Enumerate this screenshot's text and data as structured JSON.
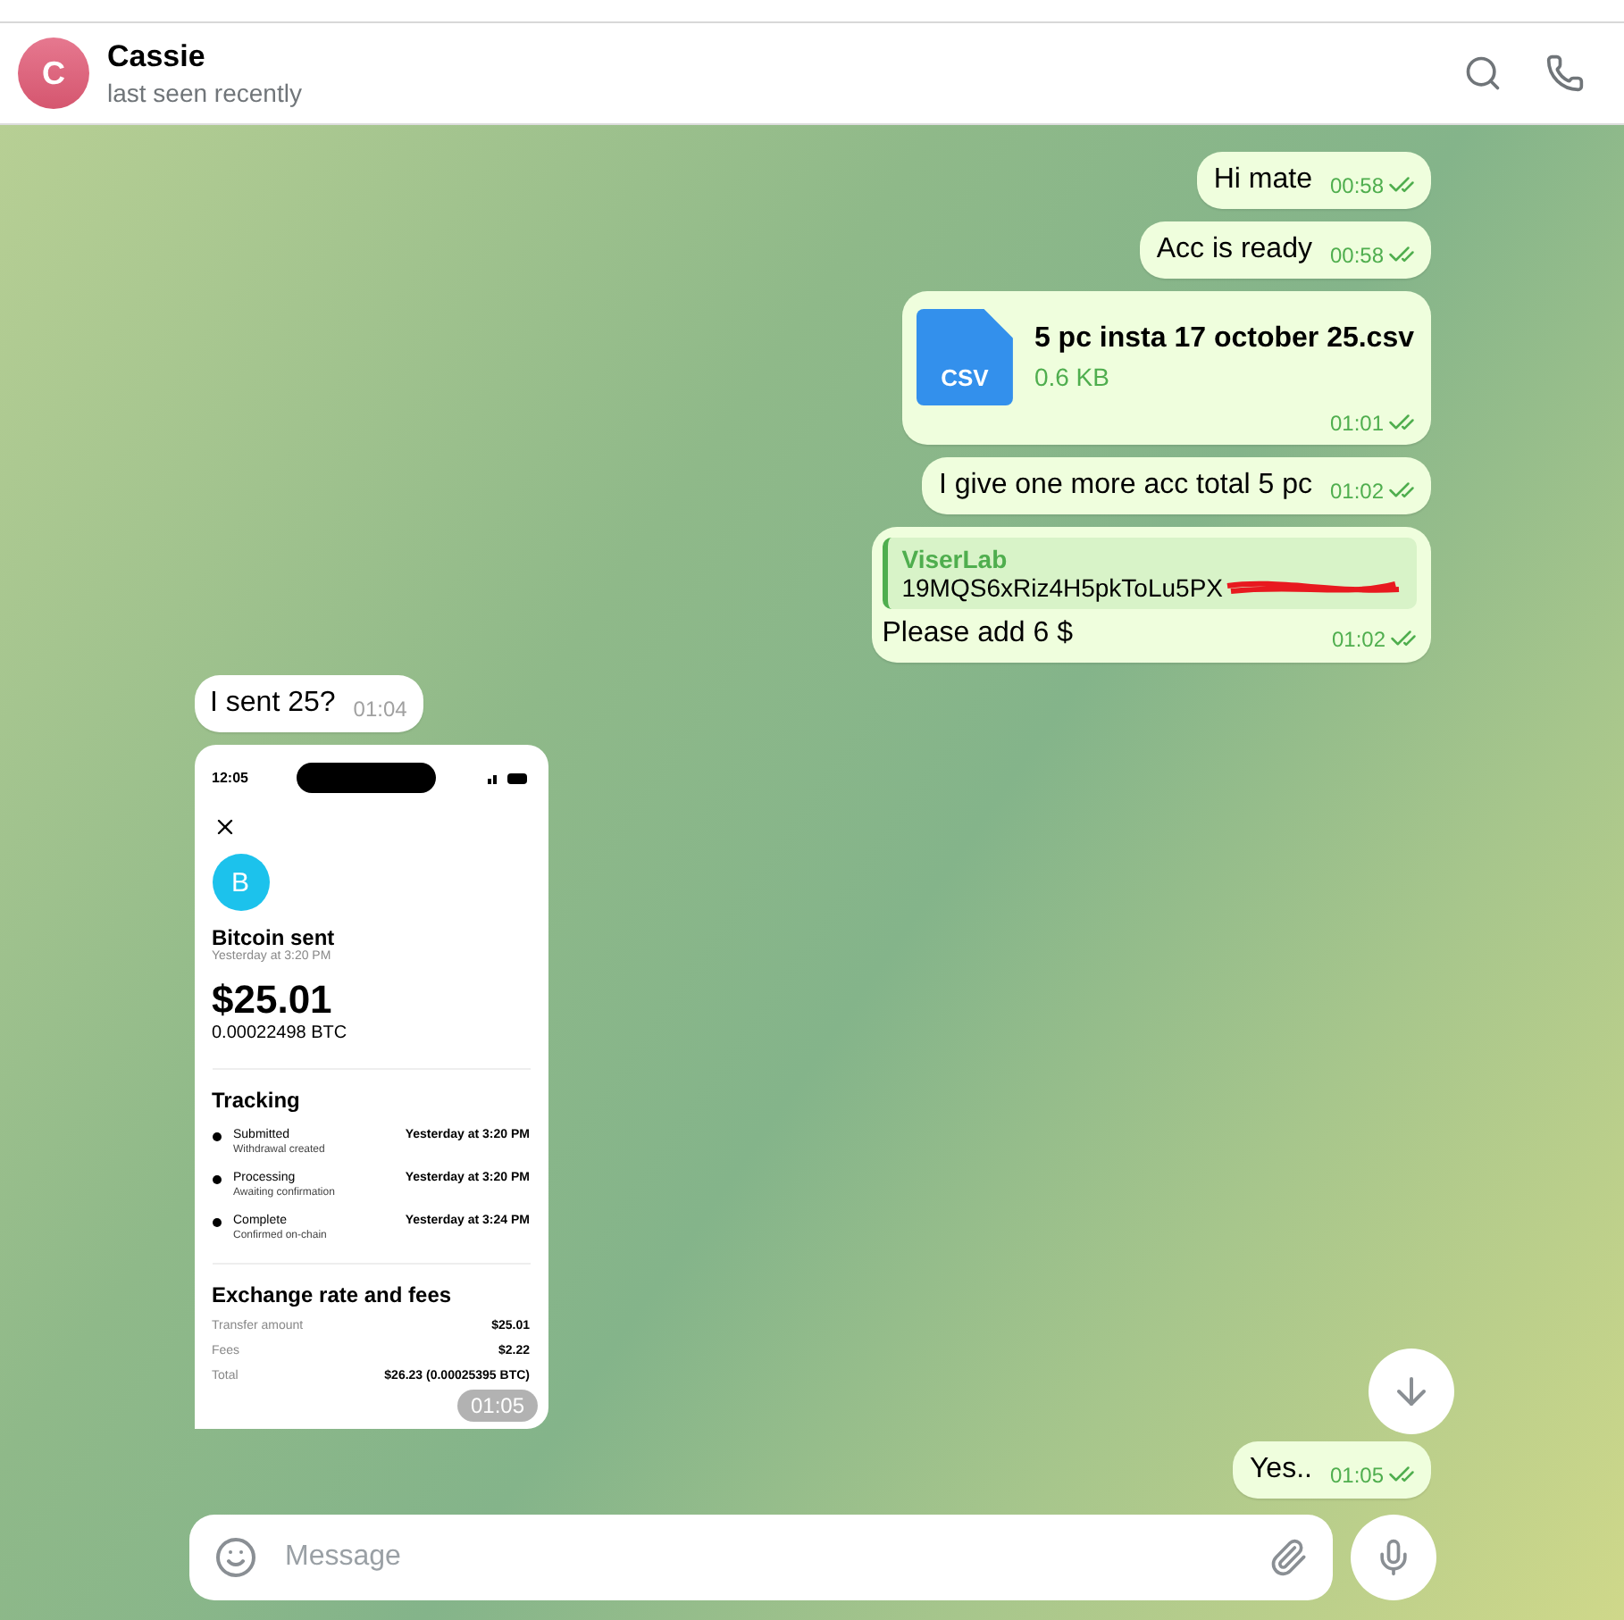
{
  "header": {
    "avatar_letter": "C",
    "name": "Cassie",
    "status": "last seen recently"
  },
  "messages": [
    {
      "kind": "text",
      "outgoing": true,
      "text": "Hi mate",
      "time": "00:58",
      "read": true
    },
    {
      "kind": "text",
      "outgoing": true,
      "text": "Acc is ready",
      "time": "00:58",
      "read": true
    },
    {
      "kind": "file",
      "outgoing": true,
      "file_type": "CSV",
      "file_name": "5 pc insta 17 october 25.csv",
      "size": "0.6 KB",
      "time": "01:01",
      "read": true
    },
    {
      "kind": "text",
      "outgoing": true,
      "text": "I give one more acc total 5 pc",
      "time": "01:02",
      "read": true
    },
    {
      "kind": "reply",
      "outgoing": true,
      "quote_author": "ViserLab",
      "quote_text": "19MQS6xRiz4H5pkToLu5PX",
      "redacted": true,
      "text": "Please add 6 $",
      "time": "01:02",
      "read": true
    },
    {
      "kind": "text",
      "outgoing": false,
      "text": "I sent 25?",
      "time": "01:04"
    },
    {
      "kind": "image",
      "outgoing": false,
      "time": "01:05",
      "screen": {
        "clock": "12:05",
        "title": "Bitcoin sent",
        "date": "Yesterday at 3:20 PM",
        "amount": "$25.01",
        "btc": "0.00022498 BTC",
        "coin_letter": "B",
        "tracking_title": "Tracking",
        "steps": [
          {
            "title": "Submitted",
            "subtitle": "Withdrawal created",
            "time": "Yesterday at 3:20 PM"
          },
          {
            "title": "Processing",
            "subtitle": "Awaiting confirmation",
            "time": "Yesterday at 3:20 PM"
          },
          {
            "title": "Complete",
            "subtitle": "Confirmed on-chain",
            "time": "Yesterday at 3:24 PM"
          }
        ],
        "fees_title": "Exchange rate and fees",
        "fees": [
          {
            "label": "Transfer amount",
            "value": "$25.01"
          },
          {
            "label": "Fees",
            "value": "$2.22"
          },
          {
            "label": "Total",
            "value": "$26.23 (0.00025395 BTC)"
          }
        ]
      }
    },
    {
      "kind": "text",
      "outgoing": true,
      "text": "Yes..",
      "time": "01:05",
      "read": true
    }
  ],
  "composer": {
    "placeholder": "Message"
  }
}
